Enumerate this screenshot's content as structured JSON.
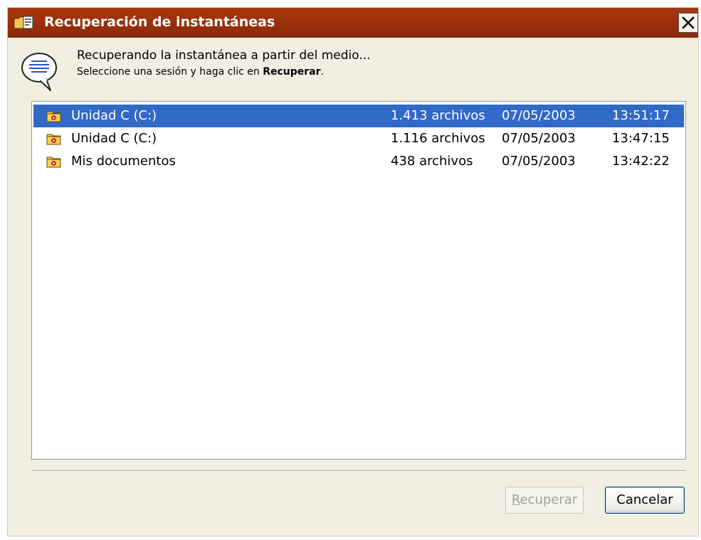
{
  "window": {
    "title": "Recuperación de instantáneas",
    "title_icon": "folder-restore-icon",
    "close_icon": "close-icon"
  },
  "header": {
    "icon": "wizard-speech-bubble-icon",
    "line1": "Recuperando la instantánea a partir del medio...",
    "line2_prefix": "Seleccione una sesión y haga clic en ",
    "line2_bold": "Recuperar",
    "line2_suffix": "."
  },
  "sessions": [
    {
      "name": "Unidad C (C:)",
      "count": "1.413 archivos",
      "date": "07/05/2003",
      "time": "13:51:17",
      "selected": true
    },
    {
      "name": "Unidad C (C:)",
      "count": "1.116 archivos",
      "date": "07/05/2003",
      "time": "13:47:15",
      "selected": false
    },
    {
      "name": "Mis documentos",
      "count": "438 archivos",
      "date": "07/05/2003",
      "time": "13:42:22",
      "selected": false
    }
  ],
  "buttons": {
    "recuperar_first": "R",
    "recuperar_rest": "ecuperar",
    "recuperar_enabled": false,
    "cancelar": "Cancelar"
  },
  "colors": {
    "titlebar": "#9a300b",
    "selection": "#3169c6",
    "dialog_bg": "#f1efe2"
  }
}
